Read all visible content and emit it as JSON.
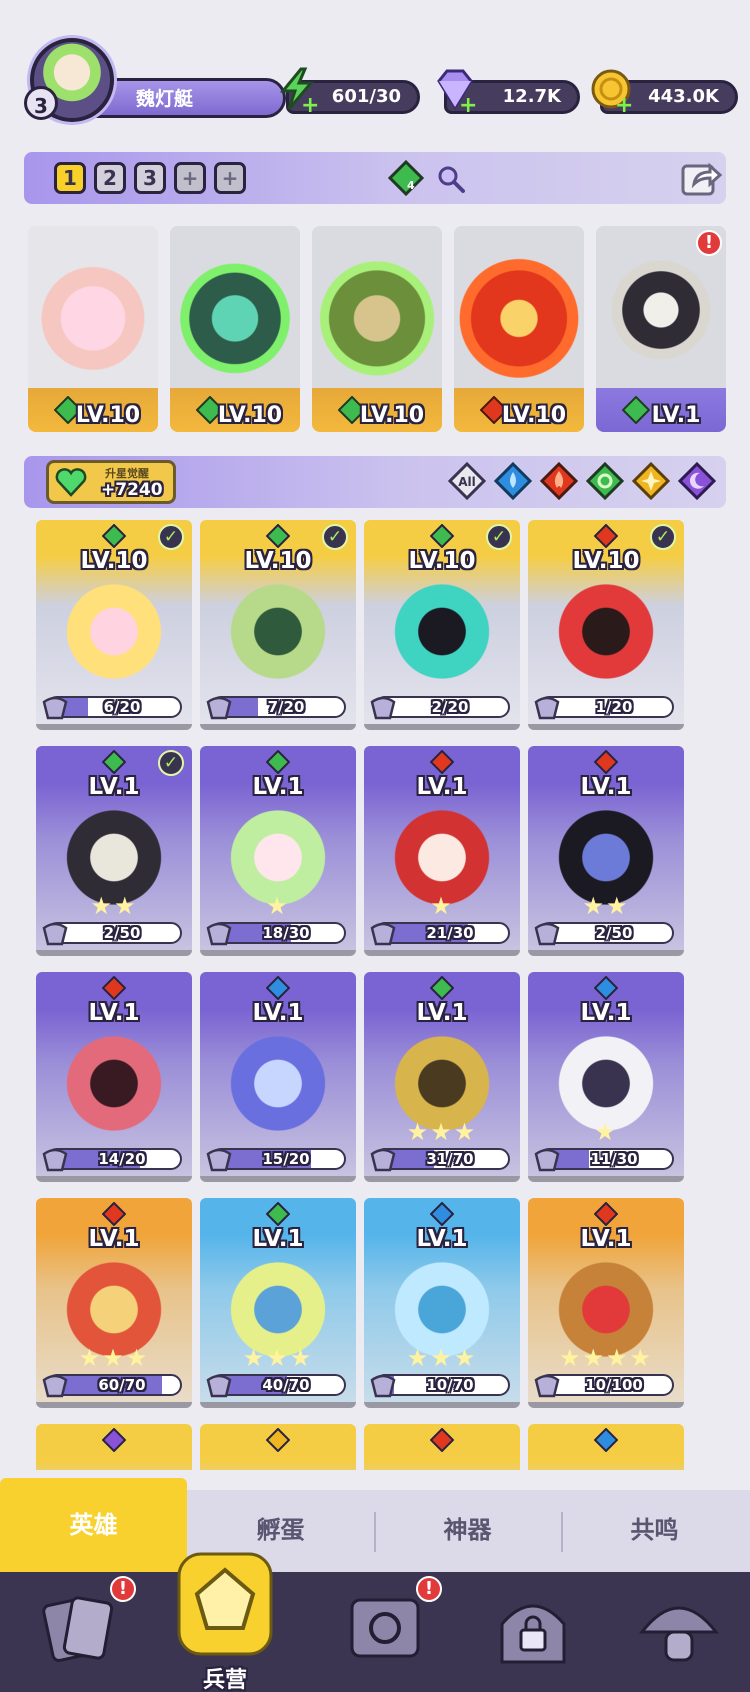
{
  "player": {
    "level": "3",
    "name": "魏灯艇"
  },
  "resources": [
    {
      "name": "energy",
      "value": "601/30",
      "icon": "lightning-icon",
      "color": "#5ad35a"
    },
    {
      "name": "gems",
      "value": "12.7K",
      "icon": "diamond-icon",
      "color": "#a98ef0"
    },
    {
      "name": "gold",
      "value": "443.0K",
      "icon": "coin-icon",
      "color": "#f7c531"
    }
  ],
  "team_tabs": {
    "tabs": [
      "1",
      "2",
      "3"
    ],
    "active": "1",
    "add_buttons": [
      "+",
      "+"
    ],
    "gem_count": "4"
  },
  "team": [
    {
      "level": "LV.10",
      "element": "wind",
      "alert": false
    },
    {
      "level": "LV.10",
      "element": "wind",
      "alert": false
    },
    {
      "level": "LV.10",
      "element": "wind",
      "alert": false
    },
    {
      "level": "LV.10",
      "element": "fire",
      "alert": false
    },
    {
      "level": "LV.1",
      "element": "wind",
      "alert": true,
      "alert_text": "!"
    }
  ],
  "awaken": {
    "title": "升星觉醒",
    "value": "+7240"
  },
  "filters": [
    {
      "name": "all",
      "label": "All"
    },
    {
      "name": "water"
    },
    {
      "name": "fire"
    },
    {
      "name": "wind"
    },
    {
      "name": "light"
    },
    {
      "name": "dark"
    }
  ],
  "heroes": [
    {
      "level": "LV.10",
      "element": "wind",
      "progress": "6/20",
      "ratio": 0.3,
      "stars": "",
      "check": true,
      "theme": "gold"
    },
    {
      "level": "LV.10",
      "element": "wind",
      "progress": "7/20",
      "ratio": 0.35,
      "stars": "",
      "check": true,
      "theme": "gold"
    },
    {
      "level": "LV.10",
      "element": "wind",
      "progress": "2/20",
      "ratio": 0.1,
      "stars": "",
      "check": true,
      "theme": "gold"
    },
    {
      "level": "LV.10",
      "element": "fire",
      "progress": "1/20",
      "ratio": 0.05,
      "stars": "",
      "check": true,
      "theme": "gold"
    },
    {
      "level": "LV.1",
      "element": "wind",
      "progress": "2/50",
      "ratio": 0.04,
      "stars": "★★",
      "check": true,
      "theme": "purple"
    },
    {
      "level": "LV.1",
      "element": "wind",
      "progress": "18/30",
      "ratio": 0.6,
      "stars": "★",
      "check": false,
      "theme": "purple"
    },
    {
      "level": "LV.1",
      "element": "fire",
      "progress": "21/30",
      "ratio": 0.7,
      "stars": "★",
      "check": false,
      "theme": "purple"
    },
    {
      "level": "LV.1",
      "element": "fire",
      "progress": "2/50",
      "ratio": 0.04,
      "stars": "★★",
      "check": false,
      "theme": "purple"
    },
    {
      "level": "LV.1",
      "element": "fire",
      "progress": "14/20",
      "ratio": 0.7,
      "stars": "",
      "check": false,
      "theme": "purple"
    },
    {
      "level": "LV.1",
      "element": "water",
      "progress": "15/20",
      "ratio": 0.75,
      "stars": "",
      "check": false,
      "theme": "purple"
    },
    {
      "level": "LV.1",
      "element": "wind",
      "progress": "31/70",
      "ratio": 0.44,
      "stars": "★★★",
      "check": false,
      "theme": "purple"
    },
    {
      "level": "LV.1",
      "element": "water",
      "progress": "11/30",
      "ratio": 0.37,
      "stars": "★",
      "check": false,
      "theme": "purple"
    },
    {
      "level": "LV.1",
      "element": "fire",
      "progress": "60/70",
      "ratio": 0.86,
      "stars": "★★★",
      "check": false,
      "theme": "orange"
    },
    {
      "level": "LV.1",
      "element": "wind",
      "progress": "40/70",
      "ratio": 0.57,
      "stars": "★★★",
      "check": false,
      "theme": "blue"
    },
    {
      "level": "LV.1",
      "element": "water",
      "progress": "10/70",
      "ratio": 0.14,
      "stars": "★★★",
      "check": false,
      "theme": "blue"
    },
    {
      "level": "LV.1",
      "element": "fire",
      "progress": "10/100",
      "ratio": 0.1,
      "stars": "★★★★",
      "check": false,
      "theme": "orange"
    },
    {
      "level": "",
      "element": "dark",
      "progress": "",
      "ratio": 0,
      "stars": "",
      "check": false,
      "theme": "gold"
    },
    {
      "level": "",
      "element": "light",
      "progress": "",
      "ratio": 0,
      "stars": "",
      "check": false,
      "theme": "gold"
    },
    {
      "level": "",
      "element": "fire",
      "progress": "",
      "ratio": 0,
      "stars": "",
      "check": false,
      "theme": "gold"
    },
    {
      "level": "",
      "element": "water",
      "progress": "",
      "ratio": 0,
      "stars": "",
      "check": false,
      "theme": "gold"
    }
  ],
  "categories": [
    {
      "label": "英雄",
      "active": true
    },
    {
      "label": "孵蛋",
      "active": false
    },
    {
      "label": "神器",
      "active": false
    },
    {
      "label": "共鸣",
      "active": false
    }
  ],
  "nav": [
    {
      "name": "cards",
      "icon": "cards-icon",
      "badge": "!"
    },
    {
      "name": "barracks",
      "icon": "barracks-icon",
      "label": "兵营",
      "active": true
    },
    {
      "name": "book",
      "icon": "book-icon",
      "badge": "!"
    },
    {
      "name": "locked",
      "icon": "lock-icon"
    },
    {
      "name": "mushroom",
      "icon": "mushroom-icon"
    }
  ],
  "colors": {
    "wind": "#3dbb4e",
    "fire": "#e0381f",
    "water": "#2f8de0",
    "light": "#f0b522",
    "dark": "#8a52d8",
    "accent": "#f8d12f"
  }
}
